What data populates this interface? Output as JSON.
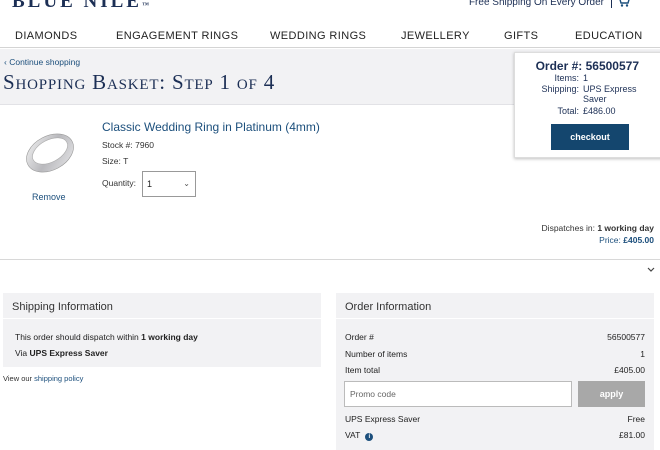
{
  "header": {
    "logo": "BLUE NILE",
    "free_shipping": "Free Shipping On Every Order"
  },
  "nav": {
    "items": [
      "DIAMONDS",
      "ENGAGEMENT RINGS",
      "WEDDING RINGS",
      "JEWELLERY",
      "GIFTS",
      "EDUCATION"
    ]
  },
  "basket": {
    "continue_link": "Continue shopping",
    "title": "Shopping Basket: Step 1 of 4"
  },
  "summary": {
    "order_label": "Order #:",
    "order_number": "56500577",
    "items_label": "Items:",
    "items_value": "1",
    "shipping_label": "Shipping:",
    "shipping_value": "UPS Express Saver",
    "total_label": "Total:",
    "total_value": "£486.00",
    "checkout_label": "checkout"
  },
  "item": {
    "name": "Classic Wedding Ring in Platinum (4mm)",
    "stock_label": "Stock #:",
    "stock_value": "7960",
    "size_label": "Size:",
    "size_value": "T",
    "quantity_label": "Quantity:",
    "quantity_value": "1",
    "remove_label": "Remove",
    "dispatch_label": "Dispatches in:",
    "dispatch_value": "1 working day",
    "price_label": "Price:",
    "price_value": "£405.00"
  },
  "shipping_info": {
    "title": "Shipping Information",
    "line1_prefix": "This order should dispatch within",
    "line1_bold": "1 working day",
    "line2_prefix": "Via",
    "line2_bold": "UPS Express Saver",
    "policy_prefix": "View our",
    "policy_link": "shipping policy"
  },
  "order_info": {
    "title": "Order Information",
    "rows": [
      {
        "label": "Order #",
        "value": "56500577"
      },
      {
        "label": "Number of items",
        "value": "1"
      },
      {
        "label": "Item total",
        "value": "£405.00"
      }
    ],
    "promo_placeholder": "Promo code",
    "apply_label": "apply",
    "shipping_label": "UPS Express Saver",
    "shipping_value": "Free",
    "vat_label": "VAT",
    "vat_value": "£81.00"
  },
  "colors": {
    "brand_navy": "#1c2f55",
    "link_blue": "#1c4f7c",
    "checkout_blue": "#14466e",
    "panel_grey": "#f2f2f4"
  },
  "icons": [
    "cart-icon",
    "chevron-left-icon",
    "chevron-down-icon",
    "info-icon",
    "ring-image"
  ]
}
